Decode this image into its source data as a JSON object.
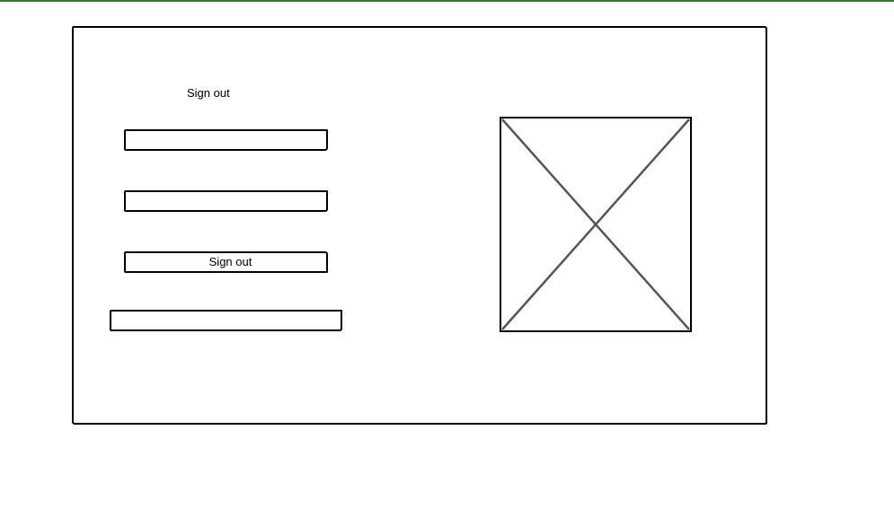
{
  "form": {
    "heading": "Sign out",
    "field_1_value": "",
    "field_2_value": "",
    "button_label": "Sign out",
    "field_3_value": ""
  },
  "colors": {
    "top_bar": "#2e7d32",
    "stroke": "#000000",
    "placeholder_cross": "#555555"
  },
  "icons": {
    "image_placeholder": "image-placeholder-icon"
  }
}
